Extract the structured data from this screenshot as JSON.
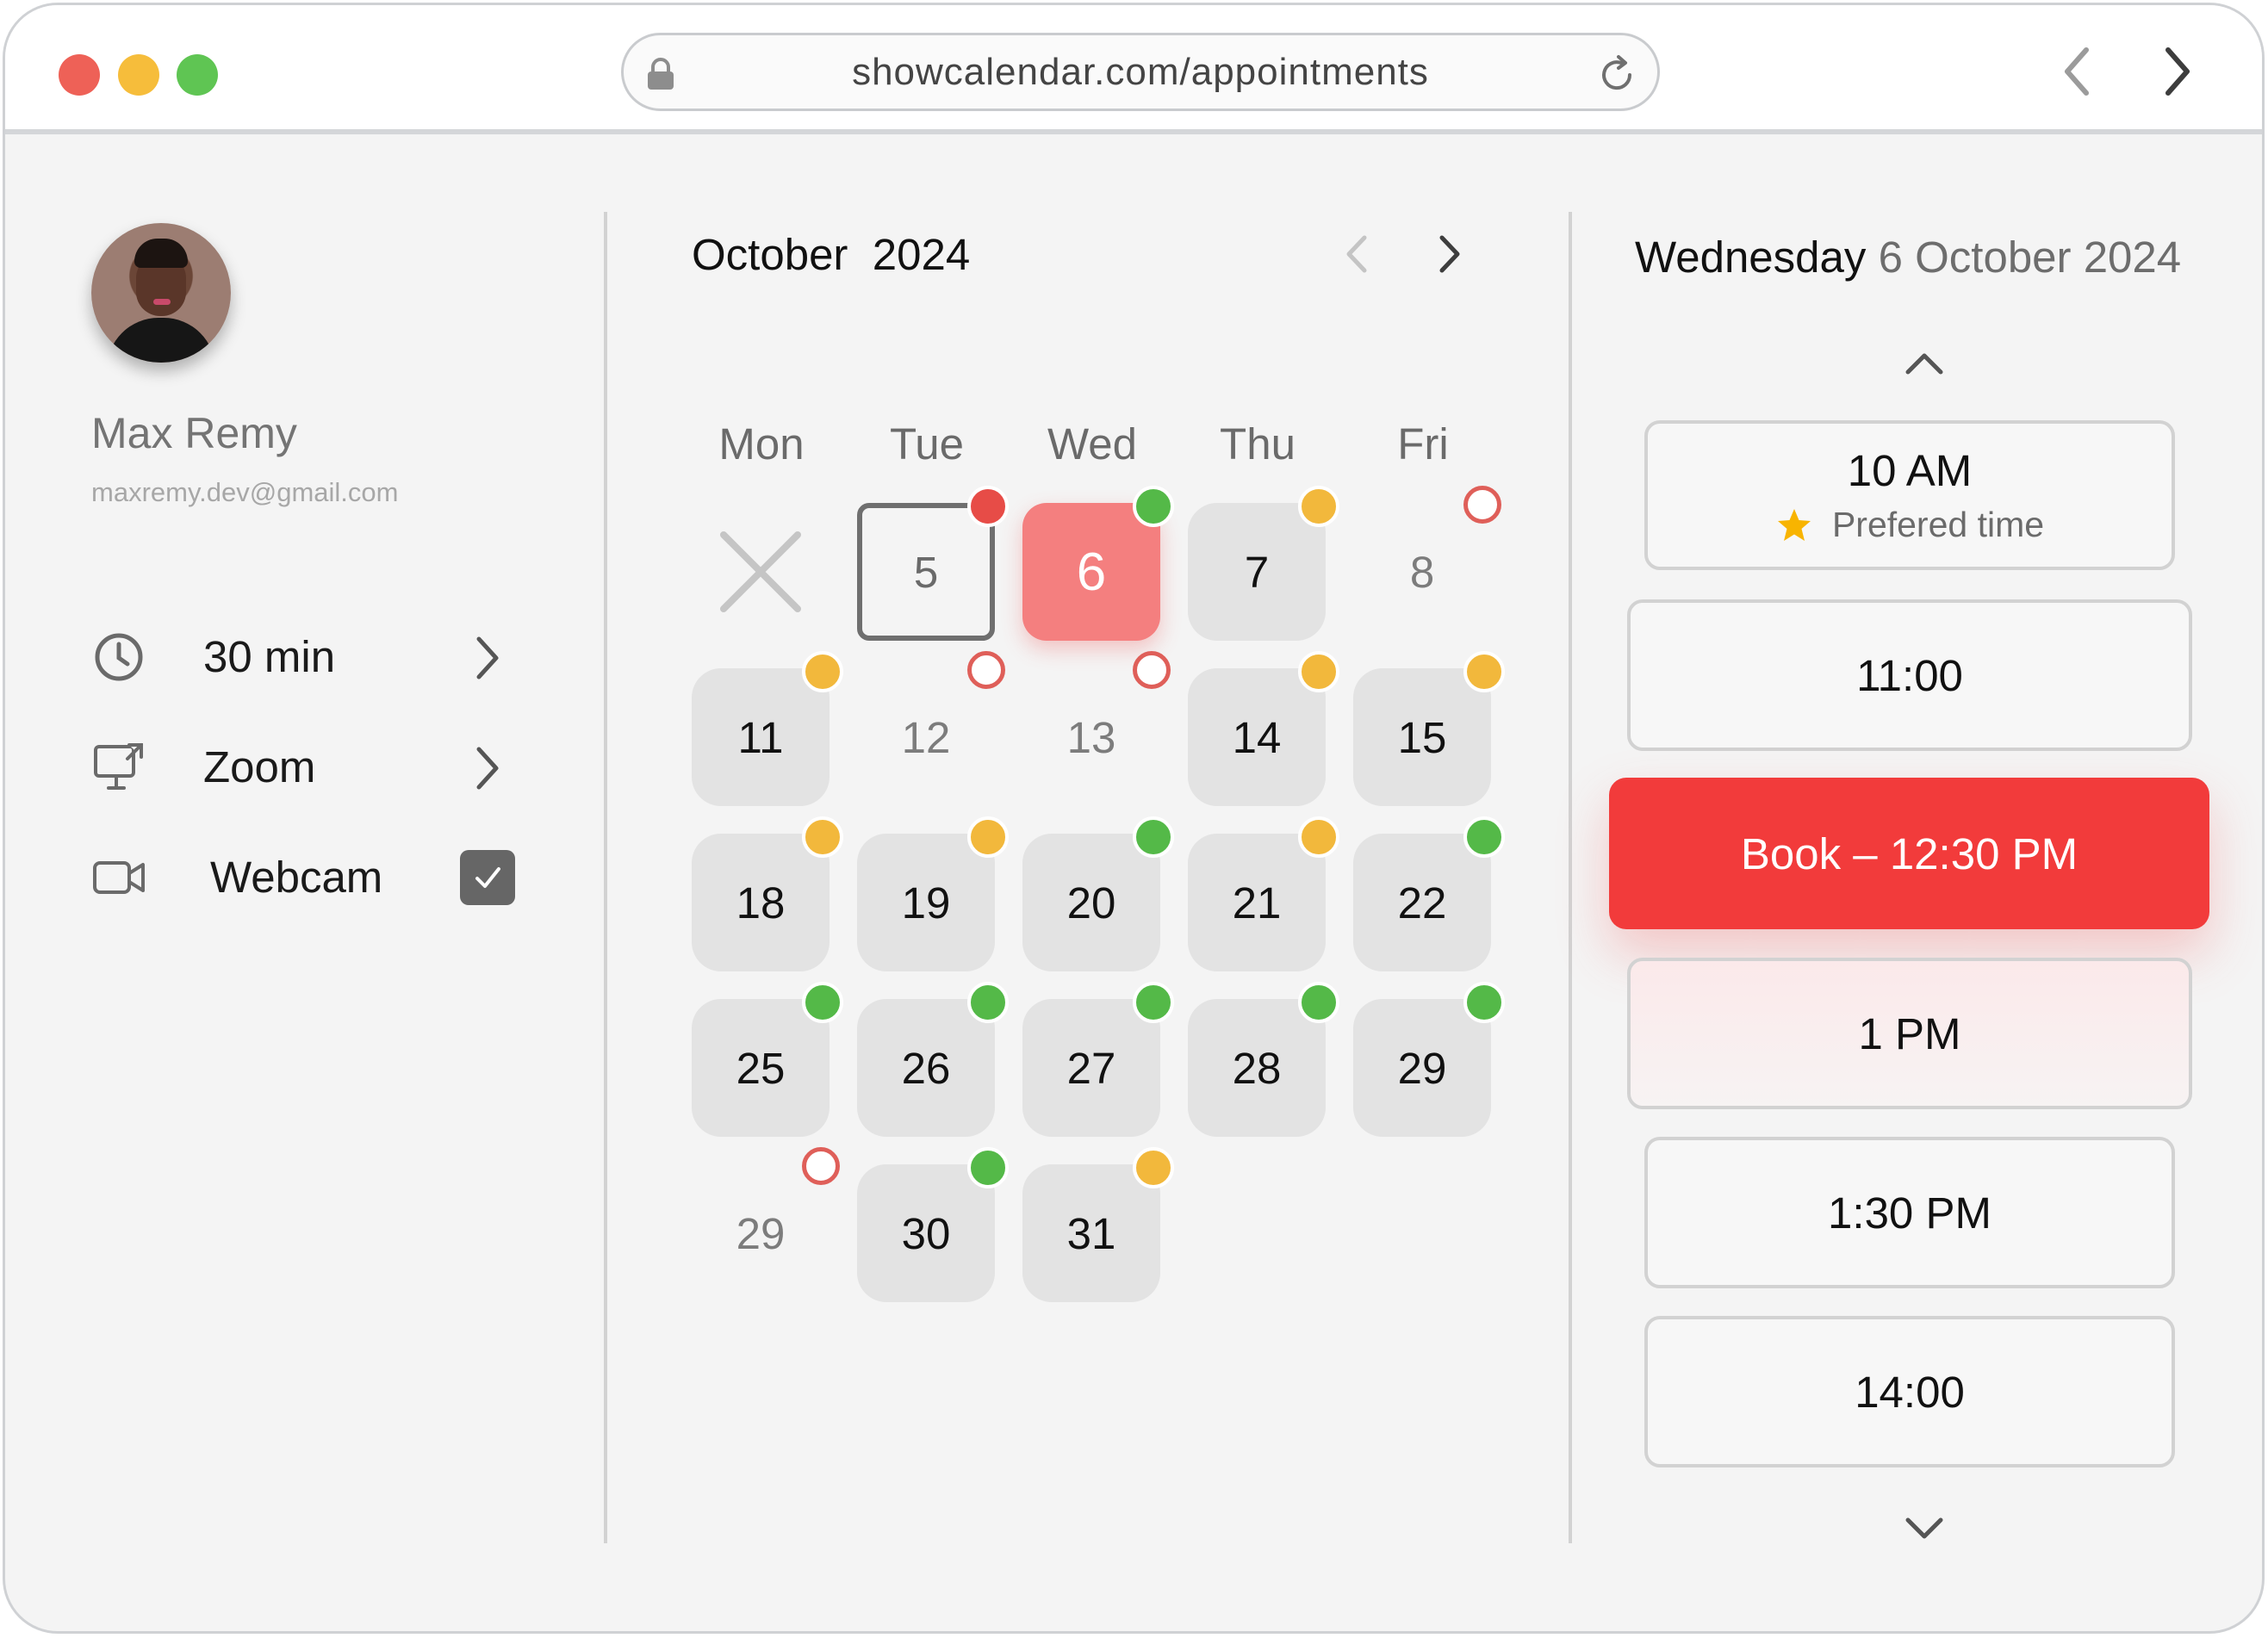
{
  "browser": {
    "url": "showcalendar.com/appointments"
  },
  "profile": {
    "name": "Max Remy",
    "email": "maxremy.dev@gmail.com"
  },
  "options": {
    "duration": "30 min",
    "platform": "Zoom",
    "webcam_label": "Webcam",
    "webcam_checked": true
  },
  "calendar": {
    "month": "October",
    "year": "2024",
    "weekdays": [
      "Mon",
      "Tue",
      "Wed",
      "Thu",
      "Fri"
    ],
    "days": [
      {
        "label": "",
        "state": "closed",
        "marker": "none"
      },
      {
        "label": "5",
        "state": "outlined",
        "marker": "red"
      },
      {
        "label": "6",
        "state": "selected",
        "marker": "green"
      },
      {
        "label": "7",
        "state": "available",
        "marker": "yellow"
      },
      {
        "label": "8",
        "state": "plain",
        "marker": "hollow"
      },
      {
        "label": "11",
        "state": "available",
        "marker": "yellow"
      },
      {
        "label": "12",
        "state": "plain",
        "marker": "hollow"
      },
      {
        "label": "13",
        "state": "plain",
        "marker": "hollow"
      },
      {
        "label": "14",
        "state": "available",
        "marker": "yellow"
      },
      {
        "label": "15",
        "state": "available",
        "marker": "yellow"
      },
      {
        "label": "18",
        "state": "available",
        "marker": "yellow"
      },
      {
        "label": "19",
        "state": "available",
        "marker": "yellow"
      },
      {
        "label": "20",
        "state": "available",
        "marker": "green"
      },
      {
        "label": "21",
        "state": "available",
        "marker": "yellow"
      },
      {
        "label": "22",
        "state": "available",
        "marker": "green"
      },
      {
        "label": "25",
        "state": "available",
        "marker": "green"
      },
      {
        "label": "26",
        "state": "available",
        "marker": "green"
      },
      {
        "label": "27",
        "state": "available",
        "marker": "green"
      },
      {
        "label": "28",
        "state": "available",
        "marker": "green"
      },
      {
        "label": "29",
        "state": "available",
        "marker": "green"
      },
      {
        "label": "29",
        "state": "plain",
        "marker": "hollow"
      },
      {
        "label": "30",
        "state": "available",
        "marker": "green"
      },
      {
        "label": "31",
        "state": "available",
        "marker": "yellow"
      }
    ]
  },
  "schedule": {
    "day_name": "Wednesday",
    "date": "6 October 2024",
    "slots": [
      {
        "label": "10 AM",
        "note": "Prefered time",
        "type": "preferred"
      },
      {
        "label": "11:00",
        "type": "normal"
      },
      {
        "label": "Book – 12:30 PM",
        "type": "book"
      },
      {
        "label": "1 PM",
        "type": "glow"
      },
      {
        "label": "1:30 PM",
        "type": "normal"
      },
      {
        "label": "14:00",
        "type": "normal"
      }
    ]
  },
  "colors": {
    "accent_red": "#f23b3b",
    "selected_day": "#f47f7f",
    "marker_green": "#54b948",
    "marker_yellow": "#f2b83c",
    "marker_red": "#e74c47"
  },
  "icons": {
    "lock": "lock-icon",
    "reload": "reload-icon",
    "back": "chevron-left-icon",
    "forward": "chevron-right-icon",
    "duration": "clock-icon",
    "platform": "screen-share-icon",
    "webcam": "video-camera-icon",
    "preferred": "star-icon"
  }
}
